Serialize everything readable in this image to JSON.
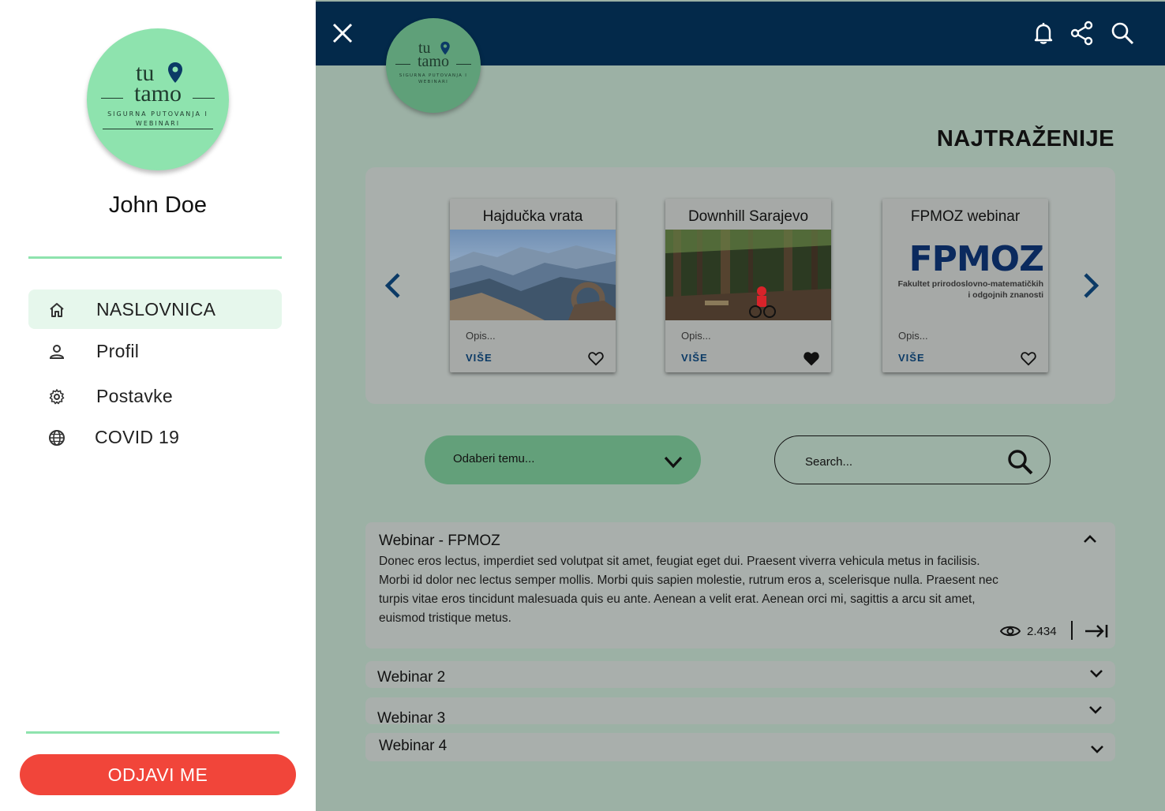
{
  "brand": {
    "logo_line1": "tu",
    "logo_line2": "tamo",
    "logo_sub1": "SIGURNA PUTOVANJA I",
    "logo_sub2": "WEBINARI"
  },
  "sidebar": {
    "user_name": "John Doe",
    "items": [
      {
        "label": "NASLOVNICA",
        "icon": "home-icon",
        "active": true
      },
      {
        "label": "Profil",
        "icon": "person-icon",
        "active": false
      },
      {
        "label": "Postavke",
        "icon": "gear-icon",
        "active": false
      },
      {
        "label": "COVID 19",
        "icon": "globe-icon",
        "active": false
      }
    ],
    "logout_label": "ODJAVI ME"
  },
  "topbar": {
    "icons": [
      "close-icon",
      "bell-icon",
      "share-icon",
      "search-icon"
    ]
  },
  "main": {
    "section_title": "NAJTRAŽENIJE",
    "cards": [
      {
        "title": "Hajdučka vrata",
        "description": "Opis...",
        "more_label": "VIŠE",
        "favorite": false
      },
      {
        "title": "Downhill Sarajevo",
        "description": "Opis...",
        "more_label": "VIŠE",
        "favorite": true
      },
      {
        "title": "FPMOZ webinar",
        "description": "Opis...",
        "more_label": "VIŠE",
        "favorite": false,
        "image_logo": "FPMOZ",
        "image_caption1": "Fakultet prirodoslovno-matematičkih",
        "image_caption2": "i odgojnih znanosti"
      }
    ],
    "topic_select": {
      "placeholder": "Odaberi temu..."
    },
    "search": {
      "placeholder": "Search..."
    },
    "webinars": [
      {
        "title": "Webinar - FPMOZ",
        "expanded": true,
        "body_lines": [
          "Donec eros lectus, imperdiet sed volutpat sit amet, feugiat eget dui. Praesent viverra vehicula metus in facilisis.",
          "Morbi id dolor nec lectus semper mollis. Morbi quis sapien molestie, rutrum eros a, scelerisque nulla. Praesent nec",
          "turpis vitae eros tincidunt malesuada quis eu ante. Aenean a velit erat. Aenean orci mi, sagittis a arcu sit amet,",
          "euismod tristique metus."
        ],
        "views": "2.434"
      },
      {
        "title": "Webinar 2",
        "expanded": false
      },
      {
        "title": "Webinar 3",
        "expanded": false
      },
      {
        "title": "Webinar 4",
        "expanded": false
      }
    ]
  },
  "colors": {
    "accent_green": "#8ee3ae",
    "navy": "#03294a",
    "logout_red": "#f1453a",
    "main_bg": "#9cb1a5"
  }
}
